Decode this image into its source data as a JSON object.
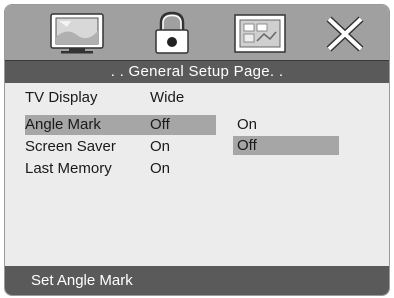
{
  "header": {
    "title": ". . General Setup Page. ."
  },
  "toolbar": {
    "icons": [
      {
        "name": "general-setup-tv-icon",
        "active": true
      },
      {
        "name": "password-lock-icon",
        "active": false
      },
      {
        "name": "preference-image-icon",
        "active": false
      },
      {
        "name": "exit-x-icon",
        "active": false
      }
    ]
  },
  "menu": {
    "items": [
      {
        "label": "TV Display",
        "value": "Wide"
      },
      {
        "label": "Angle Mark",
        "value": "Off"
      },
      {
        "label": "Screen Saver",
        "value": "On"
      },
      {
        "label": "Last Memory",
        "value": "On"
      }
    ],
    "selected_index": 1
  },
  "submenu": {
    "options": [
      "On",
      "Off"
    ],
    "highlighted_index": 1
  },
  "status": {
    "text": "Set Angle Mark"
  },
  "colors": {
    "bar_dark": "#5a5a5a",
    "icon_bar": "#a0a0a0",
    "panel": "#ececec",
    "selection": "#a6a6a6"
  }
}
